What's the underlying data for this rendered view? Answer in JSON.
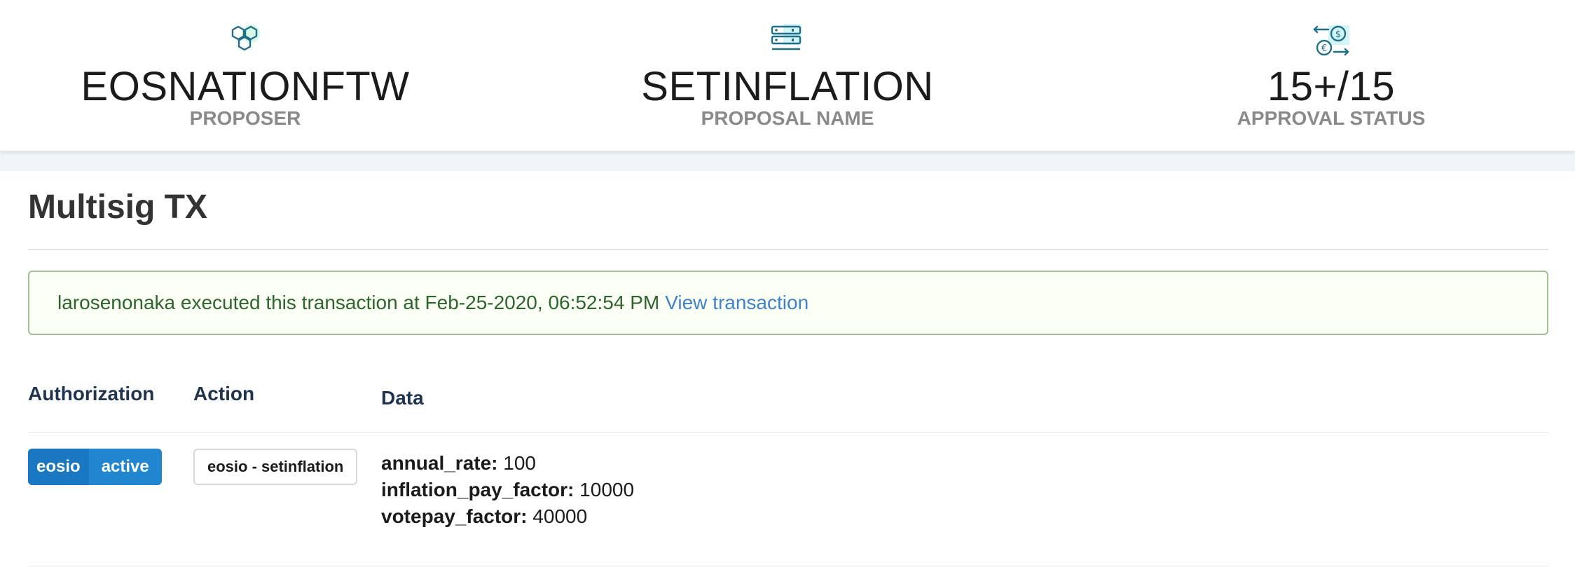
{
  "stats": {
    "proposer": {
      "value": "EOSNATIONFTW",
      "label": "PROPOSER",
      "icon": "hexagons-icon"
    },
    "proposal": {
      "value": "SETINFLATION",
      "label": "PROPOSAL NAME",
      "icon": "server-stack-icon"
    },
    "approval": {
      "value": "15+/15",
      "label": "APPROVAL STATUS",
      "icon": "currency-exchange-icon"
    }
  },
  "main": {
    "title": "Multisig TX",
    "alert": {
      "text": "larosenonaka executed this transaction at Feb-25-2020, 06:52:54 PM",
      "link": "View transaction"
    },
    "table": {
      "headers": {
        "authorization": "Authorization",
        "action": "Action",
        "data": "Data"
      },
      "row": {
        "auth_actor": "eosio",
        "auth_permission": "active",
        "action": "eosio - setinflation",
        "data": [
          {
            "key": "annual_rate:",
            "value": "100"
          },
          {
            "key": "inflation_pay_factor:",
            "value": "10000"
          },
          {
            "key": "votepay_factor:",
            "value": "40000"
          }
        ]
      }
    }
  },
  "colors": {
    "accent": "#2185d0",
    "alert_bg": "#fcfff5",
    "alert_border": "#a3c293",
    "alert_text": "#2c662d",
    "link": "#3f82cc",
    "icon_teal": "#1f6f8b",
    "icon_highlight": "#d4f5f7"
  }
}
